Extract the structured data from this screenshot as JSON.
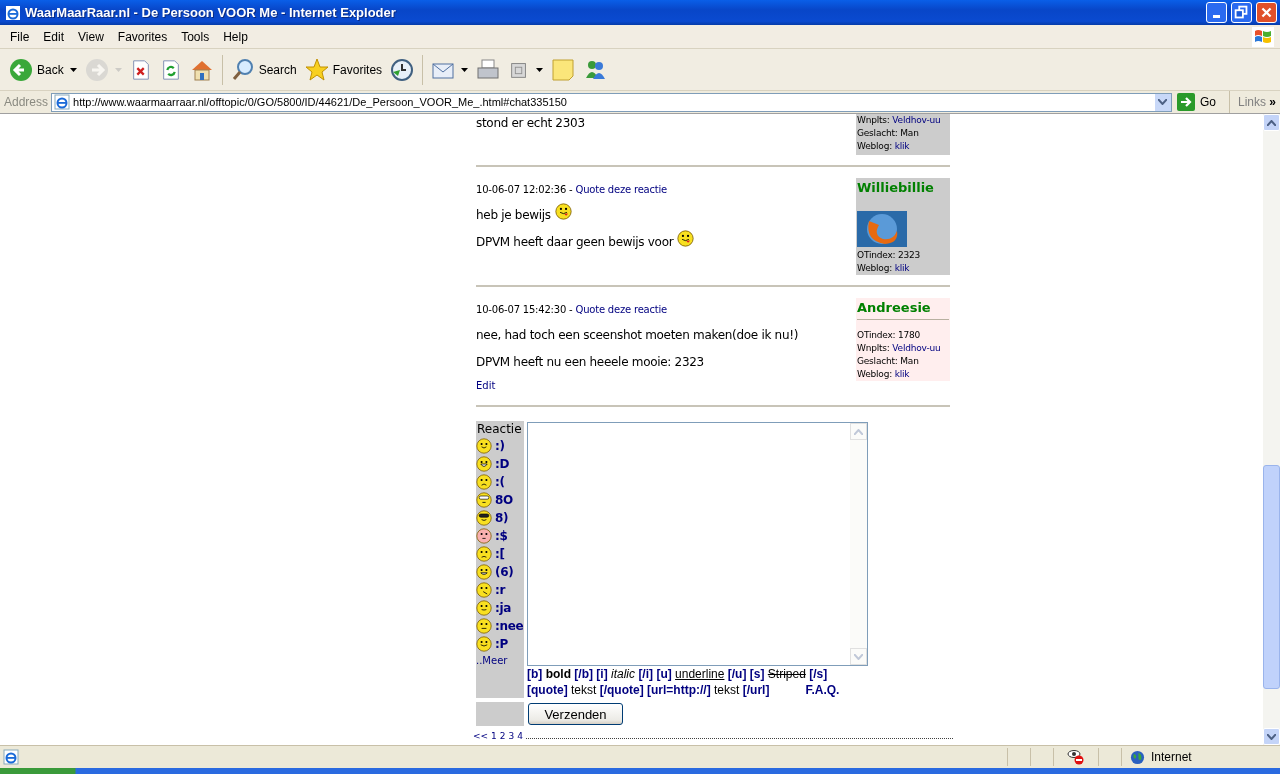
{
  "window": {
    "title": "WaarMaarRaar.nl - De Persoon VOOR Me - Internet Exploder"
  },
  "menu": [
    "File",
    "Edit",
    "View",
    "Favorites",
    "Tools",
    "Help"
  ],
  "toolbar": [
    {
      "kind": "back",
      "label": "Back",
      "dropdown": true,
      "disabled": false
    },
    {
      "kind": "forward",
      "dropdown": true,
      "disabled": true
    },
    {
      "kind": "stop",
      "dropdown": false,
      "disabled": false
    },
    {
      "kind": "refresh",
      "dropdown": false,
      "disabled": false
    },
    {
      "kind": "home",
      "dropdown": false,
      "disabled": false
    },
    {
      "kind": "search",
      "label": "Search",
      "dropdown": false,
      "disabled": false
    },
    {
      "kind": "favorites",
      "label": "Favorites",
      "dropdown": false,
      "disabled": false
    },
    {
      "kind": "history",
      "dropdown": false,
      "disabled": false
    },
    {
      "kind": "mail",
      "dropdown": true,
      "disabled": false
    },
    {
      "kind": "print",
      "dropdown": false,
      "disabled": false
    },
    {
      "kind": "edit",
      "dropdown": true,
      "disabled": false
    },
    {
      "kind": "note",
      "dropdown": false,
      "disabled": false
    },
    {
      "kind": "messenger",
      "dropdown": false,
      "disabled": false
    }
  ],
  "address": {
    "label": "Address",
    "url": "http://www.waarmaarraar.nl/offtopic/0/GO/5800/ID/44621/De_Persoon_VOOR_Me_.html#chat335150",
    "go": "Go",
    "links": "Links",
    "links_chevron": "»"
  },
  "posts": [
    {
      "lines": [
        {
          "text": "stond er echt 2303",
          "smiley": false
        }
      ],
      "profile": {
        "color": "#cccccc",
        "fields": [
          {
            "label": "Wnplts:",
            "value": "Veldhov-uu",
            "link": true
          },
          {
            "label": "Geslacht:",
            "value": "Man",
            "link": false
          },
          {
            "label": "Weblog:",
            "value": "klik",
            "link": true
          }
        ]
      }
    },
    {
      "date": "10-06-07 12:02:36",
      "separator": "-",
      "quote": "Quote deze reactie",
      "lines": [
        {
          "text": "heb je bewijs",
          "smiley": true
        },
        {
          "text": "DPVM heeft daar geen bewijs voor",
          "smiley": true
        }
      ],
      "profile": {
        "color": "#cccccc",
        "name": "Williebillie",
        "avatar": true,
        "divider": false,
        "fields": [
          {
            "label": "OTindex:",
            "value": "2323",
            "link": false
          },
          {
            "label": "Weblog:",
            "value": "klik",
            "link": true
          }
        ]
      }
    },
    {
      "date": "10-06-07 15:42:30",
      "separator": "-",
      "quote": "Quote deze reactie",
      "lines": [
        {
          "text": "nee, had toch een sceenshot moeten maken(doe ik nu!)",
          "smiley": false
        },
        {
          "text": "DPVM heeft nu een heeele mooie: 2323",
          "smiley": false
        }
      ],
      "edit": "Edit",
      "profile": {
        "color": "#ffeeee",
        "name": "Andreesie",
        "avatar": false,
        "divider": true,
        "fields": [
          {
            "label": "OTindex:",
            "value": "1780",
            "link": false
          },
          {
            "label": "Wnplts:",
            "value": "Veldhov-uu",
            "link": true
          },
          {
            "label": "Geslacht:",
            "value": "Man",
            "link": false
          },
          {
            "label": "Weblog:",
            "value": "klik",
            "link": true
          }
        ]
      }
    }
  ],
  "reply": {
    "label": "Reactie",
    "smileys": [
      {
        "code": ":)",
        "kind": "smile"
      },
      {
        "code": ":D",
        "kind": "grin"
      },
      {
        "code": ":(",
        "kind": "sad"
      },
      {
        "code": "8O",
        "kind": "shocked"
      },
      {
        "code": "8)",
        "kind": "cool"
      },
      {
        "code": ":$",
        "kind": "blush"
      },
      {
        "code": ":[",
        "kind": "worried"
      },
      {
        "code": "(6)",
        "kind": "devil"
      },
      {
        "code": ":r",
        "kind": "puke"
      },
      {
        "code": ":ja",
        "kind": "yes"
      },
      {
        "code": ":nee",
        "kind": "no"
      },
      {
        "code": ":P",
        "kind": "tongue"
      }
    ],
    "more": "..Meer",
    "help": [
      [
        {
          "text": "[b]",
          "kind": "tag"
        },
        {
          "text": "bold",
          "kind": "bold"
        },
        {
          "text": "[/b]",
          "kind": "tag"
        },
        {
          "text": "[i]",
          "kind": "tag"
        },
        {
          "text": "italic",
          "kind": "italic"
        },
        {
          "text": "[/i]",
          "kind": "tag"
        },
        {
          "text": "[u]",
          "kind": "tag"
        },
        {
          "text": "underline",
          "kind": "underline"
        },
        {
          "text": "[/u]",
          "kind": "tag"
        },
        {
          "text": "[s]",
          "kind": "tag"
        },
        {
          "text": "Striped",
          "kind": "strike"
        },
        {
          "text": "[/s]",
          "kind": "tag"
        }
      ],
      [
        {
          "text": "[quote]",
          "kind": "tag"
        },
        {
          "text": "tekst",
          "kind": "plain"
        },
        {
          "text": "[/quote]",
          "kind": "tag"
        },
        {
          "text": "[url=http://]",
          "kind": "tag"
        },
        {
          "text": "tekst",
          "kind": "plain"
        },
        {
          "text": "[/url]",
          "kind": "tag"
        }
      ]
    ],
    "faq": "F.A.Q.",
    "submit": "Verzenden"
  },
  "pagination": {
    "prev": "<<",
    "pages": [
      "1",
      "2",
      "3",
      "4"
    ]
  },
  "status_bar": {
    "zone": "Internet"
  }
}
